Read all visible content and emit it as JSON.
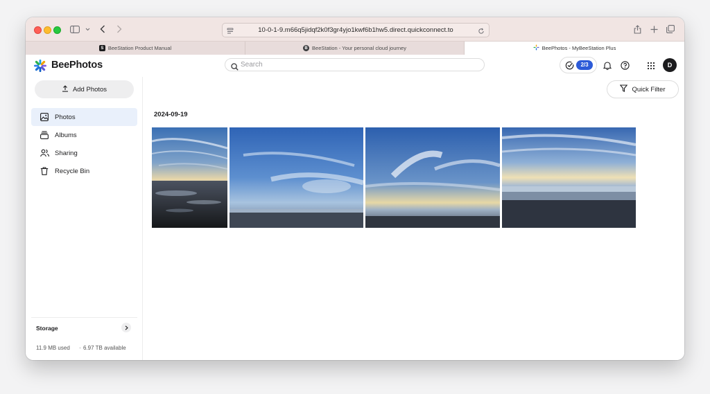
{
  "browser": {
    "url": "10-0-1-9.m66q5jidqf2k0f3gr4yjo1kwf6b1hw5.direct.quickconnect.to",
    "tabs": [
      {
        "label": "BeeStation Product Manual",
        "favicon": "S"
      },
      {
        "label": "BeeStation - Your personal cloud journey",
        "favicon": "B"
      },
      {
        "label": "BeePhotos - MyBeeStation Plus",
        "favicon": "bee"
      }
    ]
  },
  "app": {
    "name": "BeePhotos",
    "search_placeholder": "Search",
    "tasks_badge": "2/3",
    "avatar_initial": "D"
  },
  "sidebar": {
    "add_label": "Add Photos",
    "items": [
      {
        "label": "Photos",
        "icon": "image-icon",
        "active": true
      },
      {
        "label": "Albums",
        "icon": "albums-icon",
        "active": false
      },
      {
        "label": "Sharing",
        "icon": "people-icon",
        "active": false
      },
      {
        "label": "Recycle Bin",
        "icon": "trash-icon",
        "active": false
      }
    ],
    "storage": {
      "title": "Storage",
      "used": "11.9 MB used",
      "separator": "·",
      "available": "6.97 TB available"
    }
  },
  "main": {
    "quick_filter_label": "Quick Filter",
    "date_heading": "2024-09-19",
    "photos": [
      {
        "name": "photo-1",
        "description": "sunset beach with reflective wet sand and streaky clouds"
      },
      {
        "name": "photo-2",
        "description": "blue sky with wispy clouds over flat shoreline"
      },
      {
        "name": "photo-3",
        "description": "dramatic clouds with golden horizon over beach"
      },
      {
        "name": "photo-4",
        "description": "wide beach with streaked clouds and low tide"
      }
    ]
  },
  "colors": {
    "accent": "#2d5bd8",
    "active_nav": "#e9f0fb",
    "titlebar": "#f1e5e3"
  }
}
